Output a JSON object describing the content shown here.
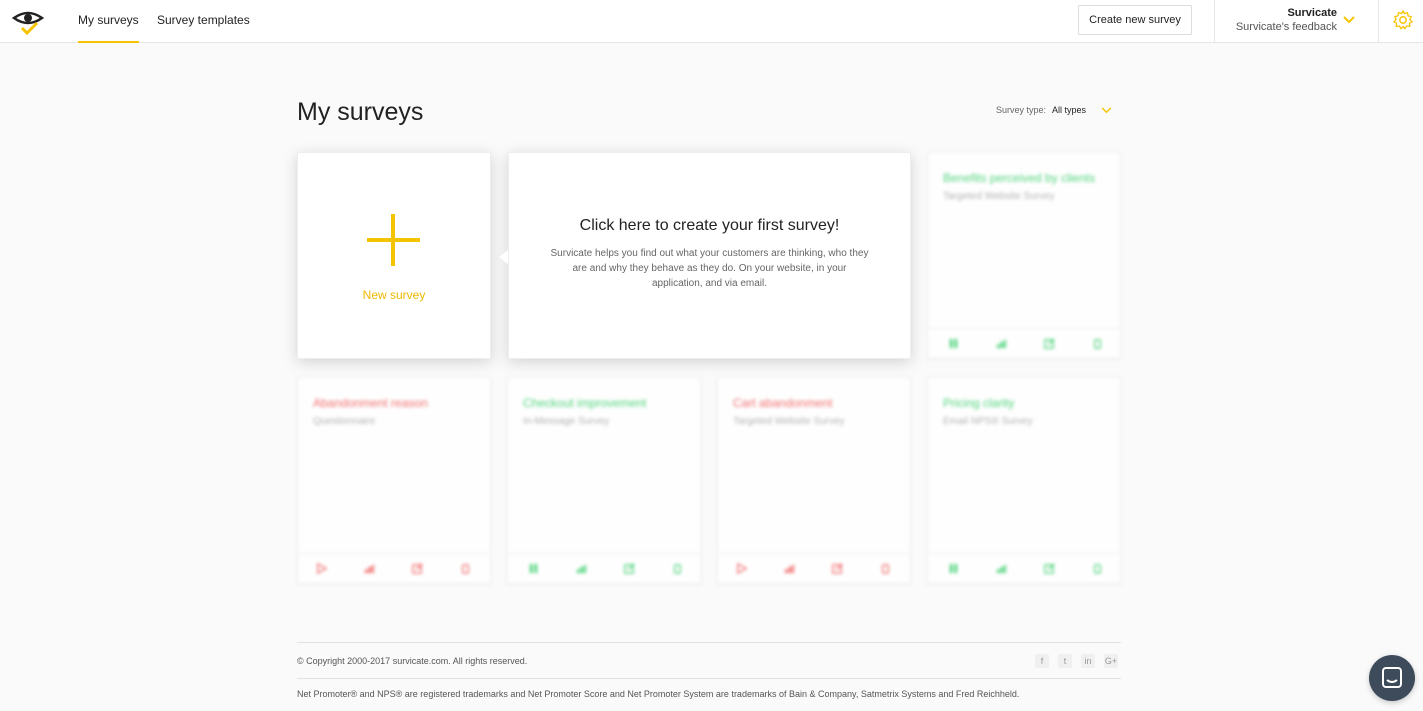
{
  "nav": {
    "tabs": [
      {
        "label": "My surveys",
        "active": true
      },
      {
        "label": "Survey templates",
        "active": false
      }
    ],
    "create_button": "Create new survey",
    "account": {
      "name": "Survicate",
      "workspace": "Survicate's feedback"
    },
    "settings_icon": "gear-icon"
  },
  "page": {
    "title": "My surveys",
    "filter_label": "Survey type:",
    "filter_value": "All types"
  },
  "new_survey": {
    "label": "New survey",
    "icon": "plus-icon"
  },
  "cta": {
    "title": "Click here to create your first survey!",
    "description": "Survicate helps you find out what your customers are thinking, who they are and why they behave as they do. On your website, in your application, and via email."
  },
  "surveys": [
    {
      "title": "Benefits perceived by clients",
      "type": "Targeted Website Survey",
      "status_color": "#3ecf6f",
      "icons": [
        "pause-icon",
        "chart-icon",
        "edit-icon",
        "trash-icon"
      ]
    },
    {
      "title": "Abandonment reason",
      "type": "Questionnaire",
      "status_color": "#f06060",
      "icons": [
        "play-icon",
        "chart-icon",
        "edit-icon",
        "trash-icon"
      ]
    },
    {
      "title": "Checkout improvement",
      "type": "In-Message Survey",
      "status_color": "#3ecf6f",
      "icons": [
        "pause-icon",
        "chart-icon",
        "edit-icon",
        "trash-icon"
      ]
    },
    {
      "title": "Cart abandonment",
      "type": "Targeted Website Survey",
      "status_color": "#f06060",
      "icons": [
        "play-icon",
        "chart-icon",
        "edit-icon",
        "trash-icon"
      ]
    },
    {
      "title": "Pricing clarity",
      "type": "Email NPS® Survey",
      "status_color": "#3ecf6f",
      "icons": [
        "pause-icon",
        "chart-icon",
        "edit-icon",
        "trash-icon"
      ]
    }
  ],
  "footer": {
    "copyright": "© Copyright 2000-2017 survicate.com. All rights reserved.",
    "social": [
      "f",
      "t",
      "in",
      "G+"
    ],
    "trademark": "Net Promoter® and NPS® are registered trademarks and Net Promoter Score and Net Promoter System are trademarks of Bain & Company, Satmetrix Systems and Fred Reichheld."
  },
  "colors": {
    "accent": "#f5c400",
    "active_green": "#3ecf6f",
    "paused_red": "#f06060",
    "chat_bubble": "#3d4b5a"
  }
}
